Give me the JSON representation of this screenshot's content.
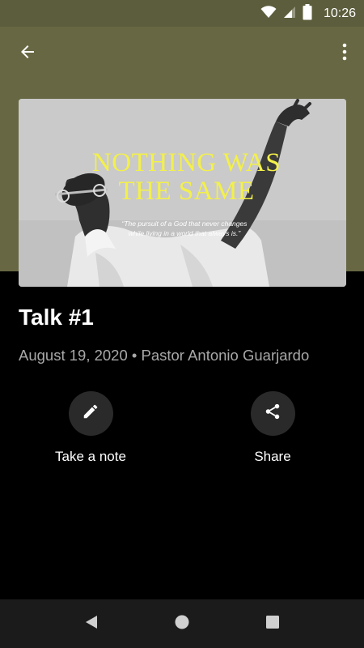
{
  "status_bar": {
    "time": "10:26",
    "icons": [
      "wifi-icon",
      "cell-signal-icon",
      "battery-icon"
    ]
  },
  "toolbar": {
    "back_icon": "arrow-back-icon",
    "menu_icon": "more-vert-icon"
  },
  "hero": {
    "title_line1": "NOTHING WAS",
    "title_line2": "THE SAME",
    "quote_line1": "“The pursuit of a God that never changes",
    "quote_line2": "while living in a world that always is.”"
  },
  "talk": {
    "title": "Talk #1",
    "meta": "August 19, 2020 • Pastor Antonio Guarjardo"
  },
  "actions": [
    {
      "label": "Take a note",
      "icon": "pencil-icon"
    },
    {
      "label": "Share",
      "icon": "share-icon"
    }
  ],
  "nav": {
    "back": "nav-back-icon",
    "home": "nav-home-icon",
    "recents": "nav-recents-icon"
  },
  "colors": {
    "header": "#676843",
    "status_bar": "#5c5d3c",
    "hero_title": "#f3f04a",
    "meta_text": "#a8a8a8",
    "action_circle": "#2a2a2a"
  }
}
